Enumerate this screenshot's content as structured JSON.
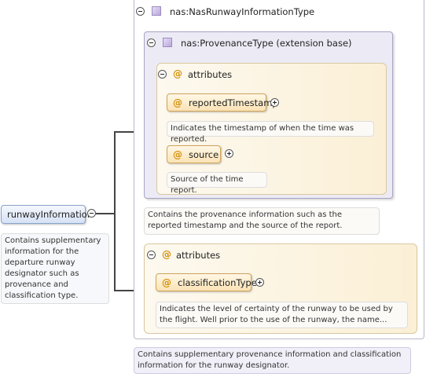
{
  "root": {
    "element_label": "runwayInformation",
    "doc": "Contains supplementary information for the departure runway designator such as provenance and classification type."
  },
  "type": {
    "name": "nas:NasRunwayInformationType",
    "doc": "Contains supplementary provenance information and classification information for the runway designator."
  },
  "extension": {
    "name": "nas:ProvenanceType (extension base)",
    "doc": "Contains the provenance information such as the reported timestamp and the source of the report.",
    "attributes_label": "attributes",
    "attributes": [
      {
        "name": "reportedTimestamp",
        "doc": "Indicates the timestamp of when the time was reported."
      },
      {
        "name": "source",
        "doc": "Source of the time report."
      }
    ]
  },
  "own_attributes": {
    "label": "attributes",
    "items": [
      {
        "name": "classificationType",
        "doc": "Indicates the level of certainty of the runway to be used by the flight. Well prior to the use of the runway, the name..."
      }
    ]
  },
  "colors": {
    "element_border": "#8aa3c8",
    "element_fill": "#e3ecfa",
    "attribute_border": "#cfa45a",
    "attribute_fill": "#fbe3b4",
    "type_fill": "#d9cff0"
  }
}
